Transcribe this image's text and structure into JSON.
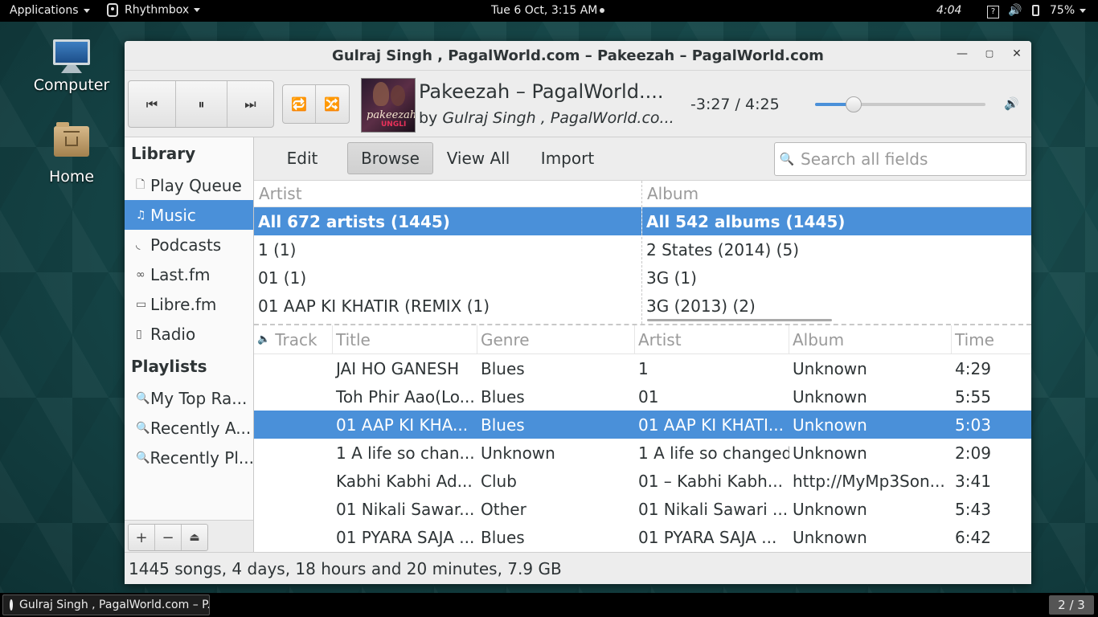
{
  "topbar": {
    "applications": "Applications",
    "app_name": "Rhythmbox",
    "datetime": "Tue  6 Oct, 3:15 AM",
    "clock2": "4:04",
    "battery": "75%"
  },
  "desktop": {
    "icons": [
      {
        "label": "Computer",
        "icon": "computer-icon"
      },
      {
        "label": "Home",
        "icon": "home-folder-icon"
      }
    ]
  },
  "window": {
    "title": "Gulraj Singh , PagalWorld.com – Pakeezah – PagalWorld.com"
  },
  "player": {
    "song_title": "Pakeezah – PagalWorld....",
    "by_label": "by",
    "artist": "Gulraj Singh , PagalWorld.co...",
    "time": "-3:27 / 4:25",
    "progress": 0.22,
    "album_art_text1": "pakeezah",
    "album_art_text2": "UNGLI"
  },
  "sidebar": {
    "library_heading": "Library",
    "library_items": [
      {
        "label": "Play Queue",
        "icon": "queue-icon"
      },
      {
        "label": "Music",
        "icon": "music-note-icon"
      },
      {
        "label": "Podcasts",
        "icon": "rss-icon"
      },
      {
        "label": "Last.fm",
        "icon": "lastfm-icon"
      },
      {
        "label": "Libre.fm",
        "icon": "librefm-icon"
      },
      {
        "label": "Radio",
        "icon": "radio-icon"
      }
    ],
    "playlists_heading": "Playlists",
    "playlist_items": [
      {
        "label": "My Top Ra...",
        "icon": "search-icon"
      },
      {
        "label": "Recently A...",
        "icon": "search-icon"
      },
      {
        "label": "Recently Pl...",
        "icon": "search-icon"
      }
    ],
    "selected": "Music"
  },
  "modebar": {
    "buttons": [
      "Edit",
      "Browse",
      "View All",
      "Import"
    ],
    "active": "Browse",
    "search_placeholder": "Search all fields"
  },
  "browser": {
    "artist_header": "Artist",
    "album_header": "Album",
    "artists": [
      "All 672 artists (1445)",
      "1 (1)",
      "01 (1)",
      "01 AAP KI KHATIR (REMIX (1)"
    ],
    "albums": [
      "All 542 albums (1445)",
      "2 States (2014) (5)",
      "3G (1)",
      "3G (2013) (2)"
    ]
  },
  "tracks": {
    "columns": [
      "Track",
      "Title",
      "Genre",
      "Artist",
      "Album",
      "Time"
    ],
    "rows": [
      {
        "track": "",
        "title": "JAI HO GANESH",
        "genre": "Blues",
        "artist": "1",
        "album": "Unknown",
        "time": "4:29"
      },
      {
        "track": "",
        "title": "Toh Phir Aao(Lo...",
        "genre": "Blues",
        "artist": "01",
        "album": "Unknown",
        "time": "5:55"
      },
      {
        "track": "",
        "title": "01 AAP KI KHA...",
        "genre": "Blues",
        "artist": "01 AAP KI KHATI...",
        "album": "Unknown",
        "time": "5:03"
      },
      {
        "track": "",
        "title": "1 A life so chan...",
        "genre": "Unknown",
        "artist": "1 A life so changed",
        "album": "Unknown",
        "time": "2:09"
      },
      {
        "track": "",
        "title": "Kabhi Kabhi Ad...",
        "genre": "Club",
        "artist": "01 – Kabhi Kabh...",
        "album": "http://MyMp3Son...",
        "time": "3:41"
      },
      {
        "track": "",
        "title": "01 Nikali Sawar...",
        "genre": "Other",
        "artist": "01 Nikali Sawari ...",
        "album": "Unknown",
        "time": "5:43"
      },
      {
        "track": "",
        "title": "01 PYARA SAJA ...",
        "genre": "Blues",
        "artist": "01 PYARA SAJA ...",
        "album": "Unknown",
        "time": "6:42"
      }
    ],
    "selected_index": 2
  },
  "status": "1445 songs, 4 days, 18 hours and 20 minutes, 7.9 GB",
  "taskbar": {
    "task_label": "Gulraj Singh , PagalWorld.com – P...",
    "workspace": "2 / 3"
  },
  "colors": {
    "selection": "#4a90d9",
    "topbar": "#000000",
    "desktop": "#154446"
  }
}
